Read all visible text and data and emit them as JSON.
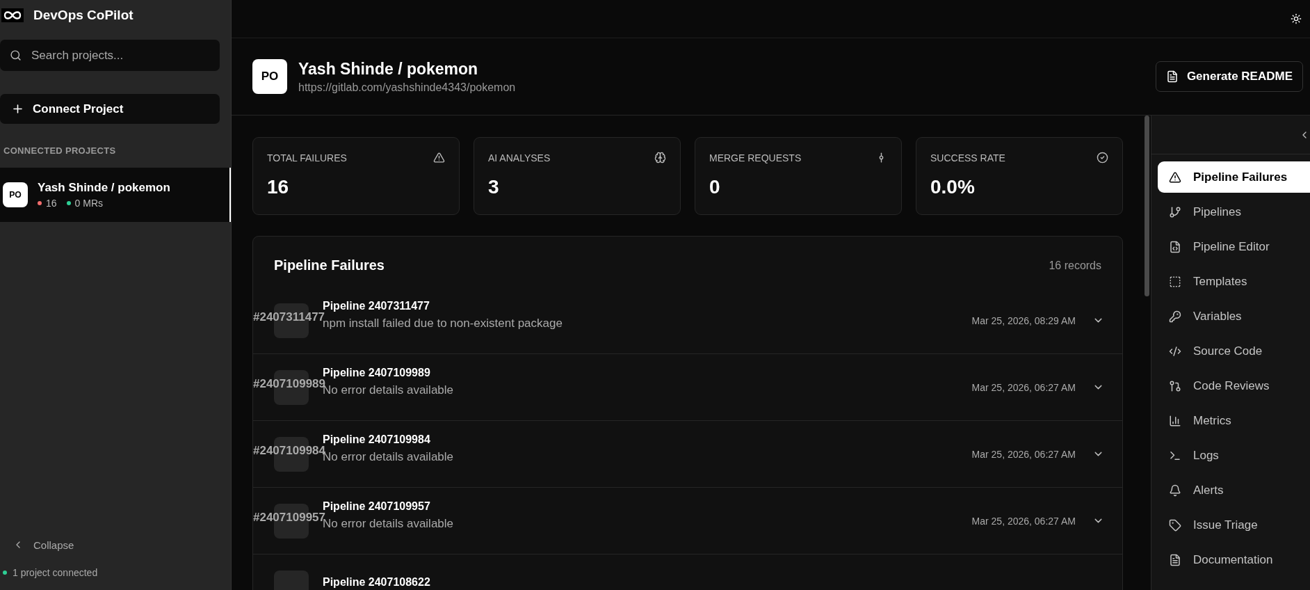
{
  "app": {
    "name": "DevOps CoPilot"
  },
  "sidebar": {
    "search": {
      "placeholder": "Search projects..."
    },
    "connect_button": "Connect Project",
    "section_title": "CONNECTED PROJECTS",
    "projects": [
      {
        "initials": "PO",
        "name": "Yash Shinde / pokemon",
        "selected": true,
        "stats": [
          {
            "text": "16",
            "color": "#f26d6d"
          },
          {
            "text": "0 MRs",
            "color": "#2ecf95"
          }
        ]
      }
    ],
    "collapse": "Collapse",
    "footer": "1 project connected"
  },
  "header": {
    "initials": "PO",
    "title": "Yash Shinde / pokemon",
    "url": "https://gitlab.com/yashshinde4343/pokemon",
    "button": "Generate README"
  },
  "stats": [
    {
      "label": "TOTAL FAILURES",
      "value": "16"
    },
    {
      "label": "AI ANALYSES",
      "value": "3"
    },
    {
      "label": "MERGE REQUESTS",
      "value": "0"
    },
    {
      "label": "SUCCESS RATE",
      "value": "0.0%"
    }
  ],
  "failures": {
    "title": "Pipeline Failures",
    "count": "16 records",
    "rows": [
      {
        "id": "#2407311477",
        "title": "Pipeline 2407311477",
        "message": "npm install failed due to non-existent package",
        "date": "Mar 25, 2026, 08:29 AM"
      },
      {
        "id": "#2407109989",
        "title": "Pipeline 2407109989",
        "message": "No error details available",
        "date": "Mar 25, 2026, 06:27 AM"
      },
      {
        "id": "#2407109984",
        "title": "Pipeline 2407109984",
        "message": "No error details available",
        "date": "Mar 25, 2026, 06:27 AM"
      },
      {
        "id": "#2407109957",
        "title": "Pipeline 2407109957",
        "message": "No error details available",
        "date": "Mar 25, 2026, 06:27 AM"
      },
      {
        "title": "Pipeline 2407108622"
      }
    ]
  },
  "nav": [
    {
      "label": "Pipeline Failures",
      "selected": true
    },
    {
      "label": "Pipelines",
      "selected": false
    },
    {
      "label": "Pipeline Editor",
      "selected": false
    },
    {
      "label": "Templates",
      "selected": false
    },
    {
      "label": "Variables",
      "selected": false
    },
    {
      "label": "Source Code",
      "selected": false
    },
    {
      "label": "Code Reviews",
      "selected": false
    },
    {
      "label": "Metrics",
      "selected": false
    },
    {
      "label": "Logs",
      "selected": false
    },
    {
      "label": "Alerts",
      "selected": false
    },
    {
      "label": "Issue Triage",
      "selected": false
    },
    {
      "label": "Documentation",
      "selected": false
    }
  ]
}
